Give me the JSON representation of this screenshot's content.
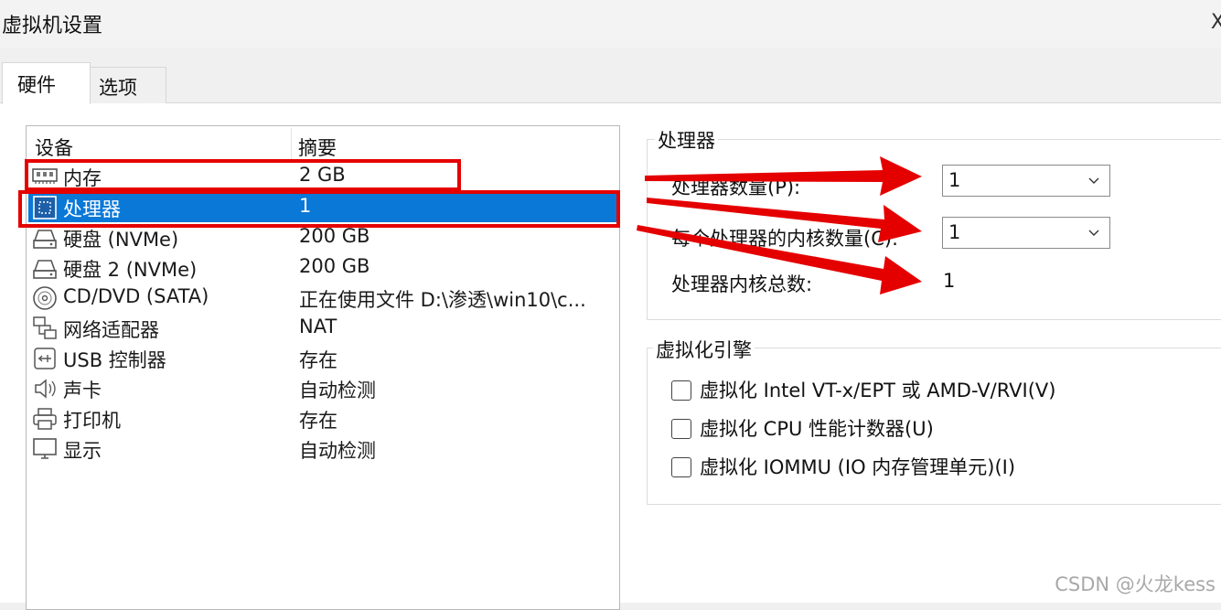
{
  "window": {
    "title": "虚拟机设置",
    "close_glyph": "X"
  },
  "tabs": [
    {
      "label": "硬件",
      "active": true
    },
    {
      "label": "选项",
      "active": false
    }
  ],
  "device_table": {
    "headers": {
      "device": "设备",
      "summary": "摘要"
    },
    "rows": [
      {
        "icon": "memory-icon",
        "name": "内存",
        "summary": "2 GB"
      },
      {
        "icon": "processor-icon",
        "name": "处理器",
        "summary": "1",
        "selected": true
      },
      {
        "icon": "hard-disk-icon",
        "name": "硬盘 (NVMe)",
        "summary": "200 GB"
      },
      {
        "icon": "hard-disk-icon",
        "name": "硬盘 2 (NVMe)",
        "summary": "200 GB"
      },
      {
        "icon": "cd-dvd-icon",
        "name": "CD/DVD (SATA)",
        "summary": "正在使用文件 D:\\渗透\\win10\\c..."
      },
      {
        "icon": "network-adapter-icon",
        "name": "网络适配器",
        "summary": "NAT"
      },
      {
        "icon": "usb-icon",
        "name": "USB 控制器",
        "summary": "存在"
      },
      {
        "icon": "sound-card-icon",
        "name": "声卡",
        "summary": "自动检测"
      },
      {
        "icon": "printer-icon",
        "name": "打印机",
        "summary": "存在"
      },
      {
        "icon": "display-icon",
        "name": "显示",
        "summary": "自动检测"
      }
    ]
  },
  "processor_group": {
    "title": "处理器",
    "processor_count": {
      "label": "处理器数量(P):",
      "value": "1"
    },
    "cores_per_processor": {
      "label": "每个处理器的内核数量(C):",
      "value": "1"
    },
    "total_cores": {
      "label": "处理器内核总数:",
      "value": "1"
    }
  },
  "virtualization_group": {
    "title": "虚拟化引擎",
    "options": [
      {
        "label": "虚拟化 Intel VT-x/EPT 或 AMD-V/RVI(V)",
        "checked": false
      },
      {
        "label": "虚拟化 CPU 性能计数器(U)",
        "checked": false
      },
      {
        "label": "虚拟化 IOMMU (IO 内存管理单元)(I)",
        "checked": false
      }
    ]
  },
  "watermark": "CSDN @火龙kess",
  "colors": {
    "selection": "#0a78d7",
    "annotation_red": "#e50000",
    "panel_bg": "#ffffff",
    "window_bg": "#f0f0f0"
  }
}
